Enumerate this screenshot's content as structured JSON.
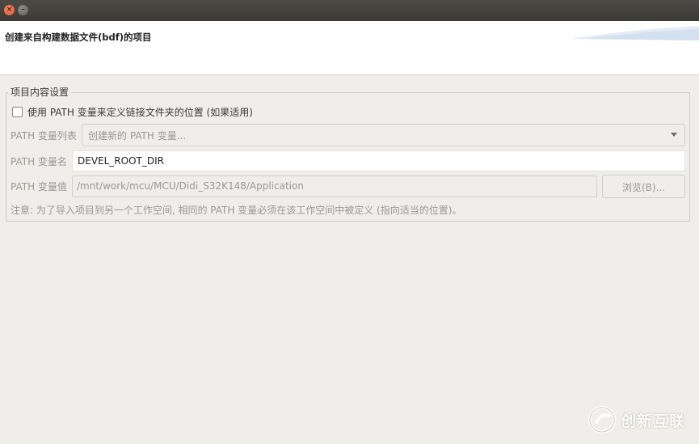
{
  "window": {
    "close_glyph": "×",
    "minimize_glyph": "–"
  },
  "banner": {
    "title": "创建来自构建数据文件(bdf)的项目"
  },
  "group": {
    "legend": "项目内容设置",
    "checkbox_label": "使用 PATH 变量来定义链接文件夹的位置 (如果适用)",
    "checkbox_checked": false,
    "path_list_label": "PATH 变量列表",
    "path_list_value": "创建新的 PATH 变量...",
    "path_name_label": "PATH 变量名",
    "path_name_value": "DEVEL_ROOT_DIR",
    "path_value_label": "PATH 变量值",
    "path_value_value": "/mnt/work/mcu/MCU/Didi_S32K148/Application",
    "browse_label": "浏览(B)...",
    "note": "注意: 为了导入项目到另一个工作空间, 相同的 PATH 变量必须在该工作空间中被定义 (指向适当的位置)。"
  },
  "watermark": {
    "text": "创新互联"
  },
  "colors": {
    "titlebar": "#3c3b37",
    "close": "#e2532a",
    "background": "#efeeeb",
    "disabled_text": "#9a9994"
  }
}
